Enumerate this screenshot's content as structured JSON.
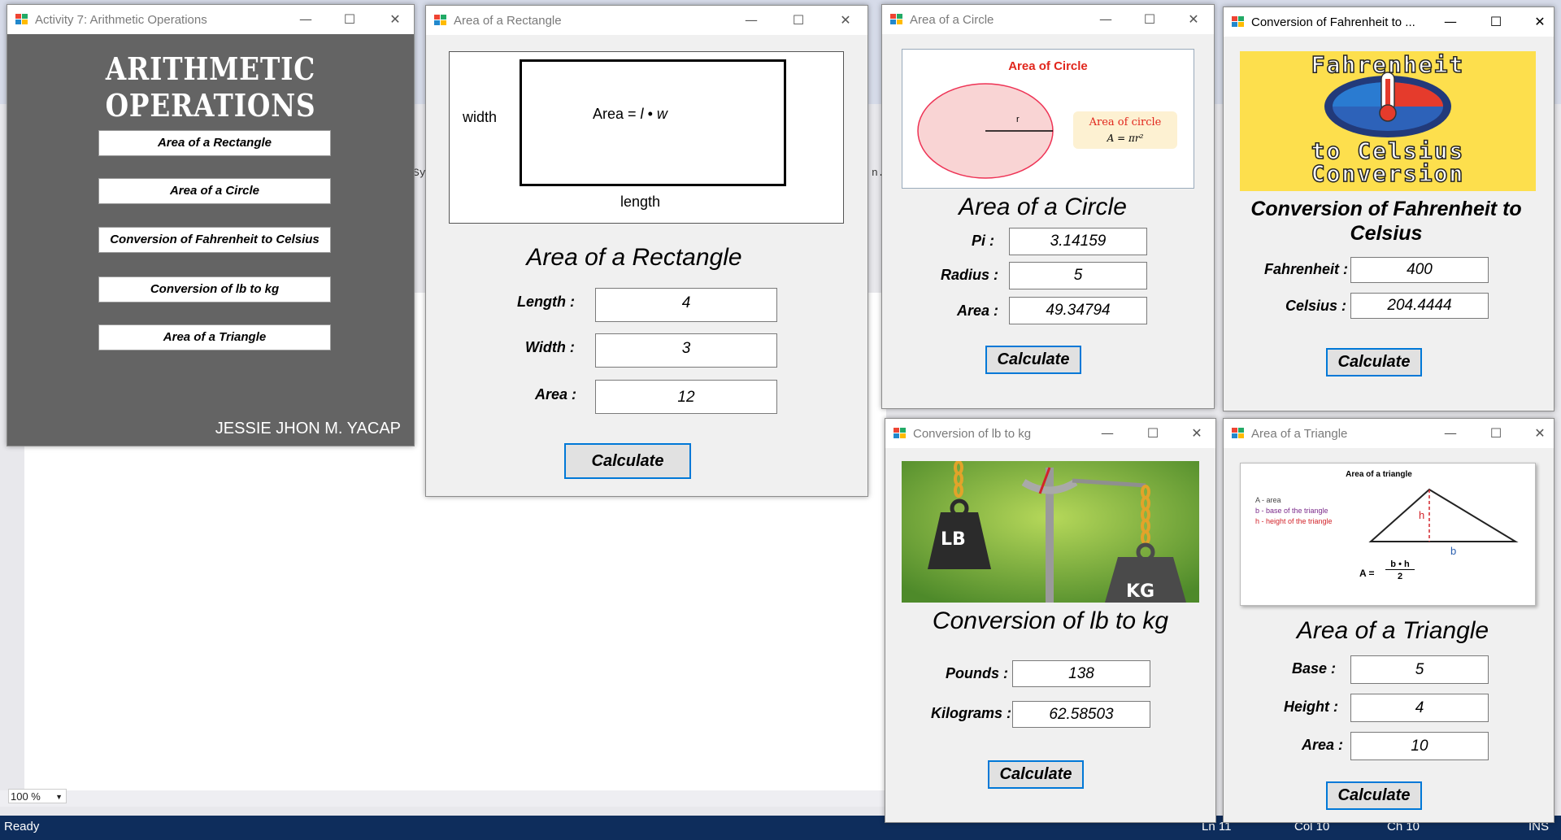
{
  "background": {
    "zoom": "100 %",
    "status_ready": "Ready",
    "status_ln": "Ln 11",
    "status_col": "Col 10",
    "status_ch": "Ch 10",
    "status_ins": "INS",
    "frag1": "Sy",
    "frag2": "n.("
  },
  "colors": {
    "accent": "#0078d7",
    "main_panel": "#646464",
    "fahrenheit_bg": "#fddf4d"
  },
  "main_window": {
    "title": "Activity 7: Arithmetic Operations",
    "heading": "ARITHMETIC OPERATIONS",
    "buttons": [
      "Area of a Rectangle",
      "Area of a Circle",
      "Conversion of Fahrenheit to Celsius",
      "Conversion of lb to kg",
      "Area of a Triangle"
    ],
    "author": "JESSIE JHON M. YACAP"
  },
  "rectangle_window": {
    "title": "Area of a Rectangle",
    "image": {
      "width": "width",
      "length": "length",
      "formula_prefix": "Area = ",
      "formula_vars": "l • w"
    },
    "heading": "Area of a Rectangle",
    "length_label": "Length :",
    "length_value": "4",
    "width_label": "Width :",
    "width_value": "3",
    "area_label": "Area :",
    "area_value": "12",
    "calculate": "Calculate"
  },
  "circle_window": {
    "title": "Area of a Circle",
    "image": {
      "title": "Area of Circle",
      "r": "r",
      "callout": "Area of circle",
      "formula": "A = πr²"
    },
    "heading": "Area of a Circle",
    "pi_label": "Pi :",
    "pi_value": "3.14159",
    "radius_label": "Radius :",
    "radius_value": "5",
    "area_label": "Area :",
    "area_value": "49.34794",
    "calculate": "Calculate"
  },
  "fahrenheit_window": {
    "title": "Conversion of Fahrenheit to ...",
    "image": {
      "line1": "Fahrenheit",
      "line2": "to Celsius",
      "line3": "Conversion"
    },
    "heading": "Conversion of Fahrenheit to Celsius",
    "fahrenheit_label": "Fahrenheit :",
    "fahrenheit_value": "400",
    "celsius_label": "Celsius :",
    "celsius_value": "204.4444",
    "calculate": "Calculate"
  },
  "lbkg_window": {
    "title": "Conversion of lb to kg",
    "image": {
      "lb": "LB",
      "kg": "KG"
    },
    "heading": "Conversion of lb to kg",
    "pounds_label": "Pounds :",
    "pounds_value": "138",
    "kilograms_label": "Kilograms :",
    "kilograms_value": "62.58503",
    "calculate": "Calculate"
  },
  "triangle_window": {
    "title": "Area of a Triangle",
    "image": {
      "title": "Area of a triangle",
      "legend_a": "A - area",
      "legend_b": "b - base of the triangle",
      "legend_h": "h - height of the triangle",
      "h": "h",
      "b": "b",
      "formula_left": "A =",
      "formula_num": "b • h",
      "formula_den": "2"
    },
    "heading": "Area of a Triangle",
    "base_label": "Base :",
    "base_value": "5",
    "height_label": "Height :",
    "height_value": "4",
    "area_label": "Area :",
    "area_value": "10",
    "calculate": "Calculate"
  }
}
